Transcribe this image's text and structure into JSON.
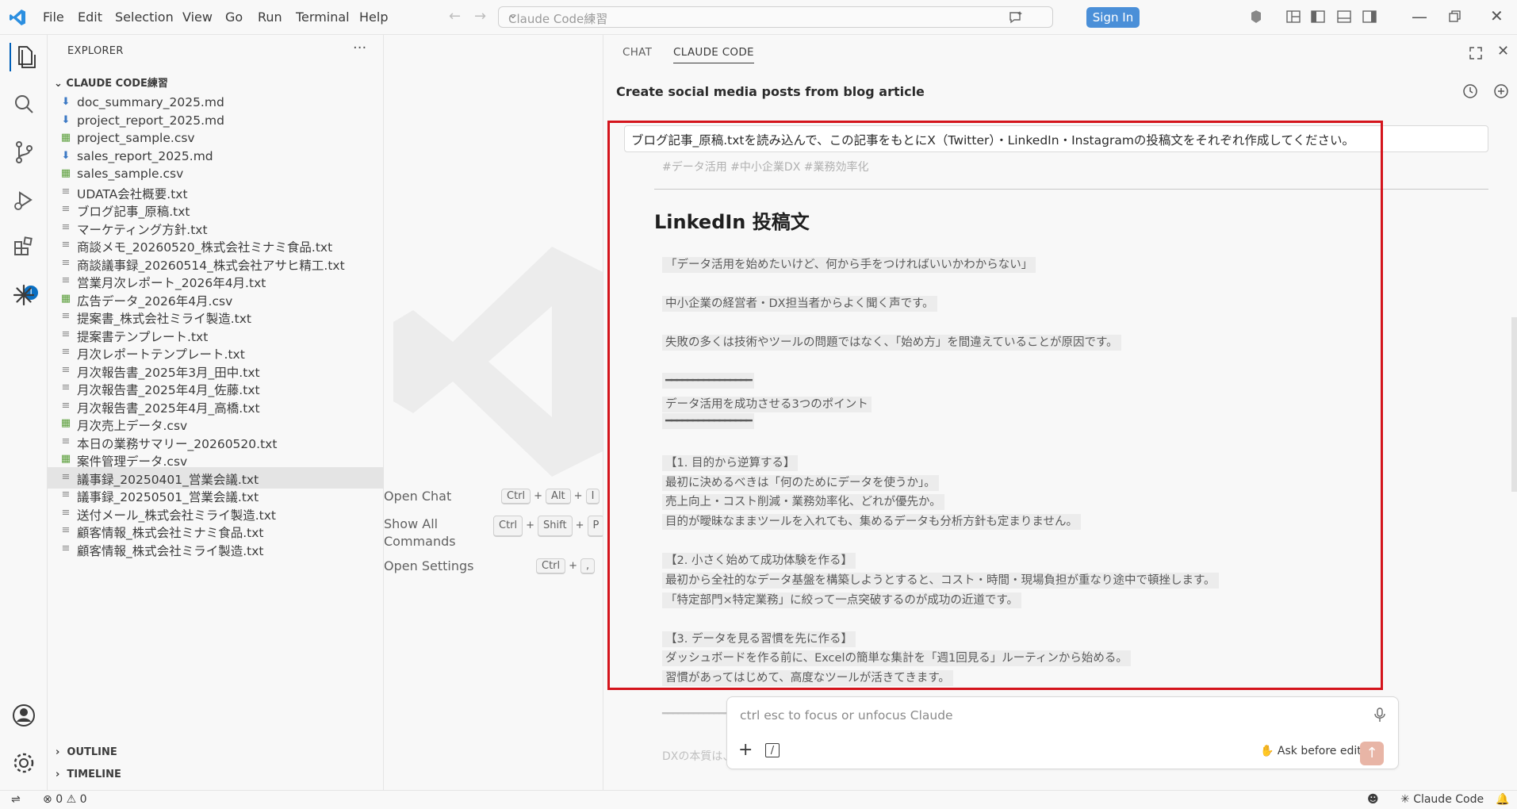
{
  "titlebar": {
    "menu": [
      "File",
      "Edit",
      "Selection",
      "View",
      "Go",
      "Run",
      "Terminal",
      "Help"
    ],
    "search_text": "Claude Code練習",
    "sign_in_label": "Sign In"
  },
  "activity_badge": "1",
  "explorer": {
    "title": "EXPLORER",
    "more": "···",
    "folder": "CLAUDE CODE練習",
    "files": [
      {
        "name": "doc_summary_2025.md",
        "type": "md"
      },
      {
        "name": "project_report_2025.md",
        "type": "md"
      },
      {
        "name": "project_sample.csv",
        "type": "csv"
      },
      {
        "name": "sales_report_2025.md",
        "type": "md"
      },
      {
        "name": "sales_sample.csv",
        "type": "csv"
      },
      {
        "name": "UDATA会社概要.txt",
        "type": "txt"
      },
      {
        "name": "ブログ記事_原稿.txt",
        "type": "txt"
      },
      {
        "name": "マーケティング方針.txt",
        "type": "txt"
      },
      {
        "name": "商談メモ_20260520_株式会社ミナミ食品.txt",
        "type": "txt"
      },
      {
        "name": "商談議事録_20260514_株式会社アサヒ精工.txt",
        "type": "txt"
      },
      {
        "name": "営業月次レポート_2026年4月.txt",
        "type": "txt"
      },
      {
        "name": "広告データ_2026年4月.csv",
        "type": "csv"
      },
      {
        "name": "提案書_株式会社ミライ製造.txt",
        "type": "txt"
      },
      {
        "name": "提案書テンプレート.txt",
        "type": "txt"
      },
      {
        "name": "月次レポートテンプレート.txt",
        "type": "txt"
      },
      {
        "name": "月次報告書_2025年3月_田中.txt",
        "type": "txt"
      },
      {
        "name": "月次報告書_2025年4月_佐藤.txt",
        "type": "txt"
      },
      {
        "name": "月次報告書_2025年4月_高橋.txt",
        "type": "txt"
      },
      {
        "name": "月次売上データ.csv",
        "type": "csv"
      },
      {
        "name": "本日の業務サマリー_20260520.txt",
        "type": "txt"
      },
      {
        "name": "案件管理データ.csv",
        "type": "csv"
      },
      {
        "name": "議事録_20250401_営業会議.txt",
        "type": "txt",
        "selected": true
      },
      {
        "name": "議事録_20250501_営業会議.txt",
        "type": "txt"
      },
      {
        "name": "送付メール_株式会社ミライ製造.txt",
        "type": "txt"
      },
      {
        "name": "顧客情報_株式会社ミナミ食品.txt",
        "type": "txt"
      },
      {
        "name": "顧客情報_株式会社ミライ製造.txt",
        "type": "txt"
      }
    ],
    "outline": "OUTLINE",
    "timeline": "TIMELINE"
  },
  "welcome": {
    "open_chat": "Open Chat",
    "show_all_1": "Show All",
    "show_all_2": "Commands",
    "open_settings": "Open Settings",
    "k_ctrl": "Ctrl",
    "k_alt": "Alt",
    "k_i": "I",
    "k_shift": "Shift",
    "k_p": "P",
    "k_comma": ",",
    "plus": "+"
  },
  "panel": {
    "tab_chat": "CHAT",
    "tab_claude": "CLAUDE CODE",
    "session_title": "Create social media posts from blog article",
    "prompt": "ブログ記事_原稿.txtを読み込んで、この記事をもとにX（Twitter）・LinkedIn・Instagramの投稿文をそれぞれ作成してください。",
    "cut_hashtags": "#データ活用 #中小企業DX #業務効率化",
    "linkedin_heading": "LinkedIn 投稿文",
    "lines": [
      "「データ活用を始めたいけど、何から手をつければいいかわからない」",
      "中小企業の経営者・DX担当者からよく聞く声です。",
      "失敗の多くは技術やツールの問題ではなく、「始め方」を間違えていることが原因です。",
      "━━━━━━━━━━━━━━━━",
      "データ活用を成功させる3つのポイント",
      "━━━━━━━━━━━━━━━━",
      "【1. 目的から逆算する】",
      "最初に決めるべきは「何のためにデータを使うか」。",
      "売上向上・コスト削減・業務効率化、どれが優先か。",
      "目的が曖昧なままツールを入れても、集めるデータも分析方針も定まりません。",
      "【2. 小さく始めて成功体験を作る】",
      "最初から全社的なデータ基盤を構築しようとすると、コスト・時間・現場負担が重なり途中で頓挫します。",
      "「特定部門×特定業務」に絞って一点突破するのが成功の近道です。",
      "【3. データを見る習慣を先に作る】",
      "ダッシュボードを作る前に、Excelの簡単な集計を「週1回見る」ルーティンから始める。",
      "習慣があってはじめて、高度なツールが活きてきます。",
      "━━━━━━━━━━━━━━━━",
      "DXの本質は、"
    ]
  },
  "input": {
    "placeholder": "ctrl esc to focus or unfocus Claude",
    "mode": "Ask before edits"
  },
  "statusbar": {
    "errors": "0",
    "warnings": "0",
    "claude": "Claude Code"
  }
}
